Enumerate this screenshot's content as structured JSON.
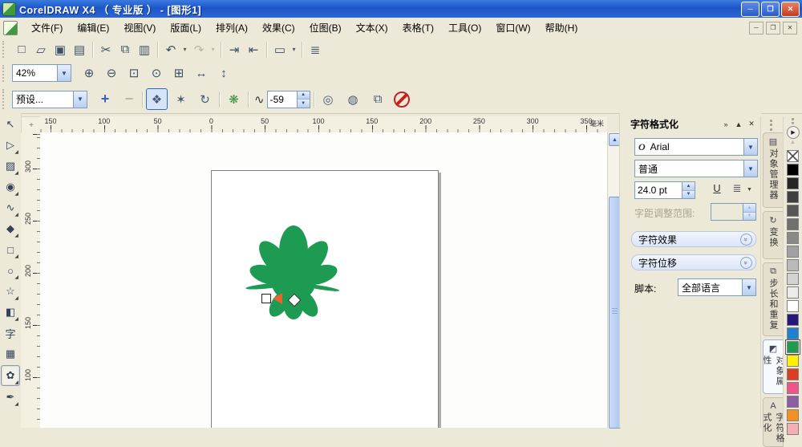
{
  "window": {
    "title": "CorelDRAW X4 （ 专业版 ） - [图形1]",
    "controls": {
      "minimize": "─",
      "restore": "❐",
      "close": "✕"
    }
  },
  "menu_bar": {
    "items": [
      "文件(F)",
      "编辑(E)",
      "视图(V)",
      "版面(L)",
      "排列(A)",
      "效果(C)",
      "位图(B)",
      "文本(X)",
      "表格(T)",
      "工具(O)",
      "窗口(W)",
      "帮助(H)"
    ],
    "doc_controls": {
      "minimize": "─",
      "restore": "❐",
      "close": "✕"
    }
  },
  "std_toolbar": {
    "buttons": [
      {
        "name": "new-document-icon",
        "glyph": "□"
      },
      {
        "name": "open-icon",
        "glyph": "▱"
      },
      {
        "name": "save-icon",
        "glyph": "▣"
      },
      {
        "name": "print-icon",
        "glyph": "▤"
      },
      {
        "sep": true
      },
      {
        "name": "cut-icon",
        "glyph": "✂"
      },
      {
        "name": "copy-icon",
        "glyph": "⧉"
      },
      {
        "name": "paste-icon",
        "glyph": "▥"
      },
      {
        "sep": true
      },
      {
        "name": "undo-icon",
        "glyph": "↶"
      },
      {
        "name": "undo-dropdown-icon",
        "glyph": "▾",
        "small": true
      },
      {
        "name": "redo-icon",
        "glyph": "↷",
        "disabled": true
      },
      {
        "name": "redo-dropdown-icon",
        "glyph": "▾",
        "small": true,
        "disabled": true
      },
      {
        "sep": true
      },
      {
        "name": "import-icon",
        "glyph": "⇥"
      },
      {
        "name": "export-icon",
        "glyph": "⇤"
      },
      {
        "sep": true
      },
      {
        "name": "application-launcher-icon",
        "glyph": "▭"
      },
      {
        "name": "launcher-dropdown-icon",
        "glyph": "▾",
        "small": true
      },
      {
        "sep": true
      },
      {
        "name": "options-icon",
        "glyph": "≣"
      }
    ]
  },
  "zoom_bar": {
    "zoom_value": "42%",
    "buttons": [
      {
        "name": "zoom-in-icon",
        "glyph": "⊕"
      },
      {
        "name": "zoom-out-icon",
        "glyph": "⊖"
      },
      {
        "name": "zoom-to-selection-icon",
        "glyph": "⊡"
      },
      {
        "name": "zoom-to-all-objects-icon",
        "glyph": "⊙"
      },
      {
        "name": "zoom-to-page-icon",
        "glyph": "⊞"
      },
      {
        "name": "zoom-to-page-width-icon",
        "glyph": "↔"
      },
      {
        "name": "zoom-to-page-height-icon",
        "glyph": "↕"
      }
    ]
  },
  "prop_bar": {
    "preset_value": "预设...",
    "add_glyph": "+",
    "delete_glyph": "−",
    "distortion_modes": [
      {
        "name": "push-pull-distortion-icon",
        "glyph": "❖",
        "active": true
      },
      {
        "name": "zipper-distortion-icon",
        "glyph": "✶"
      },
      {
        "name": "twister-distortion-icon",
        "glyph": "↻"
      }
    ],
    "new_distortion_glyph": "❋",
    "amplitude_glyph": "∿",
    "amplitude_value": "-59",
    "extra_buttons": [
      {
        "name": "center-distortion-icon",
        "glyph": "◎"
      },
      {
        "name": "distortion-curve-icon",
        "glyph": "◍"
      },
      {
        "name": "copy-distortion-properties-icon",
        "glyph": "⧉"
      }
    ]
  },
  "rulers": {
    "h_numbers": [
      "150",
      "100",
      "50",
      "0",
      "50",
      "100",
      "150",
      "200",
      "250",
      "300",
      "350"
    ],
    "v_numbers": [
      "300",
      "250",
      "200",
      "150",
      "100"
    ],
    "unit": "毫米",
    "origin_glyph": "+"
  },
  "toolbox": {
    "tools": [
      {
        "name": "pick-tool",
        "glyph": "↖"
      },
      {
        "name": "shape-tool",
        "glyph": "▷",
        "flyout": true
      },
      {
        "name": "crop-tool",
        "glyph": "▨",
        "flyout": true
      },
      {
        "name": "zoom-tool",
        "glyph": "◉",
        "flyout": true
      },
      {
        "name": "freehand-tool",
        "glyph": "∿",
        "flyout": true
      },
      {
        "name": "smart-fill-tool",
        "glyph": "◆",
        "flyout": true
      },
      {
        "name": "rectangle-tool",
        "glyph": "□",
        "flyout": true
      },
      {
        "name": "ellipse-tool",
        "glyph": "○",
        "flyout": true
      },
      {
        "name": "polygon-tool",
        "glyph": "☆",
        "flyout": true
      },
      {
        "name": "basic-shapes-tool",
        "glyph": "◧",
        "flyout": true
      },
      {
        "name": "text-tool",
        "glyph": "字"
      },
      {
        "name": "table-tool",
        "glyph": "▦"
      },
      {
        "name": "interactive-distortion-tool",
        "glyph": "✿",
        "flyout": true,
        "active": true
      },
      {
        "name": "eyedropper-tool",
        "glyph": "✒",
        "flyout": true
      }
    ]
  },
  "canvas": {
    "shape_color": "#1E9B52"
  },
  "scrollbar": {
    "up_glyph": "▲"
  },
  "docker": {
    "title": "字符格式化",
    "header_buttons": [
      "»",
      "▲",
      "✕"
    ],
    "font_icon": "O",
    "font_name": "Arial",
    "style_value": "普通",
    "size_value": "24.0 pt",
    "underline_label": "U",
    "charlist_glyph": "≣",
    "combo_arrow": "▼",
    "spin_up": "▲",
    "spin_down": "▼",
    "kerning_label": "字距调整范围:",
    "section_chevron": "»",
    "sections": [
      {
        "label": "字符效果"
      },
      {
        "label": "字符位移"
      }
    ],
    "script_label": "脚本:",
    "script_value": "全部语言"
  },
  "docker_tabs": [
    {
      "name": "docker-tab-object-manager",
      "label": "对象管理器",
      "glyph": "▤"
    },
    {
      "name": "docker-tab-transform",
      "label": "变换",
      "glyph": "↻"
    },
    {
      "name": "docker-tab-step-and-repeat",
      "label": "步长和重复",
      "glyph": "⧉"
    },
    {
      "name": "docker-tab-object-properties",
      "label": "对象属性",
      "glyph": "◩",
      "active": true
    },
    {
      "name": "docker-tab-character-formatting",
      "label": "字符格式化",
      "glyph": "A"
    }
  ],
  "palette": {
    "flyout_glyph": "▶",
    "up_glyph": "▲",
    "colors": [
      "none",
      "#000000",
      "#262626",
      "#3F3F3F",
      "#575757",
      "#707070",
      "#898989",
      "#A1A1A1",
      "#BABABA",
      "#D2D2D2",
      "#EBEBEB",
      "#FFFFFF",
      "#25177E",
      "#1E81D2",
      "#1F9B4D",
      "#FFF101",
      "#DD3B22",
      "#F0548B",
      "#8E5BA5",
      "#F59121",
      "#F7ADB4"
    ],
    "selected_index": 14
  }
}
